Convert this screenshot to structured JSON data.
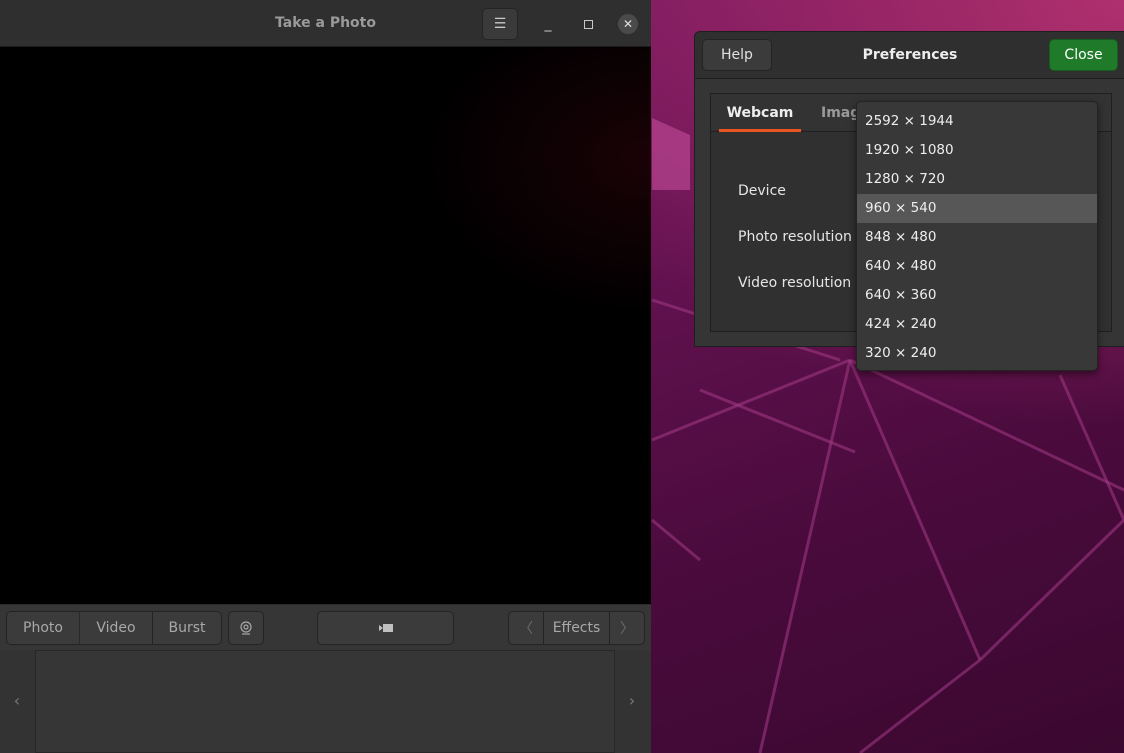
{
  "camera_window": {
    "title": "Take a Photo",
    "menu_icon": "hamburger-menu-icon",
    "minimize_icon": "minimize-icon",
    "maximize_icon": "maximize-icon",
    "close_icon": "close-icon",
    "modes": [
      {
        "label": "Photo"
      },
      {
        "label": "Video"
      },
      {
        "label": "Burst"
      }
    ],
    "effects_label": "Effects",
    "capture_icon": "video-camera-icon",
    "effects_icon": "flower-icon"
  },
  "preferences": {
    "title": "Preferences",
    "help_label": "Help",
    "close_label": "Close",
    "tabs": [
      {
        "label": "Webcam"
      },
      {
        "label": "Imag"
      }
    ],
    "fields": {
      "device": "Device",
      "photo_resolution": "Photo resolution",
      "video_resolution": "Video resolution"
    },
    "resolution_options": [
      {
        "label": "2592 × 1944"
      },
      {
        "label": "1920 × 1080"
      },
      {
        "label": "1280 × 720"
      },
      {
        "label": "960 × 540"
      },
      {
        "label": "848 × 480"
      },
      {
        "label": "640 × 480"
      },
      {
        "label": "640 × 360"
      },
      {
        "label": "424 × 240"
      },
      {
        "label": "320 × 240"
      }
    ],
    "selected_resolution": "960 × 540"
  },
  "colors": {
    "accent_tab": "#e95420",
    "close_button": "#1f7a29"
  }
}
